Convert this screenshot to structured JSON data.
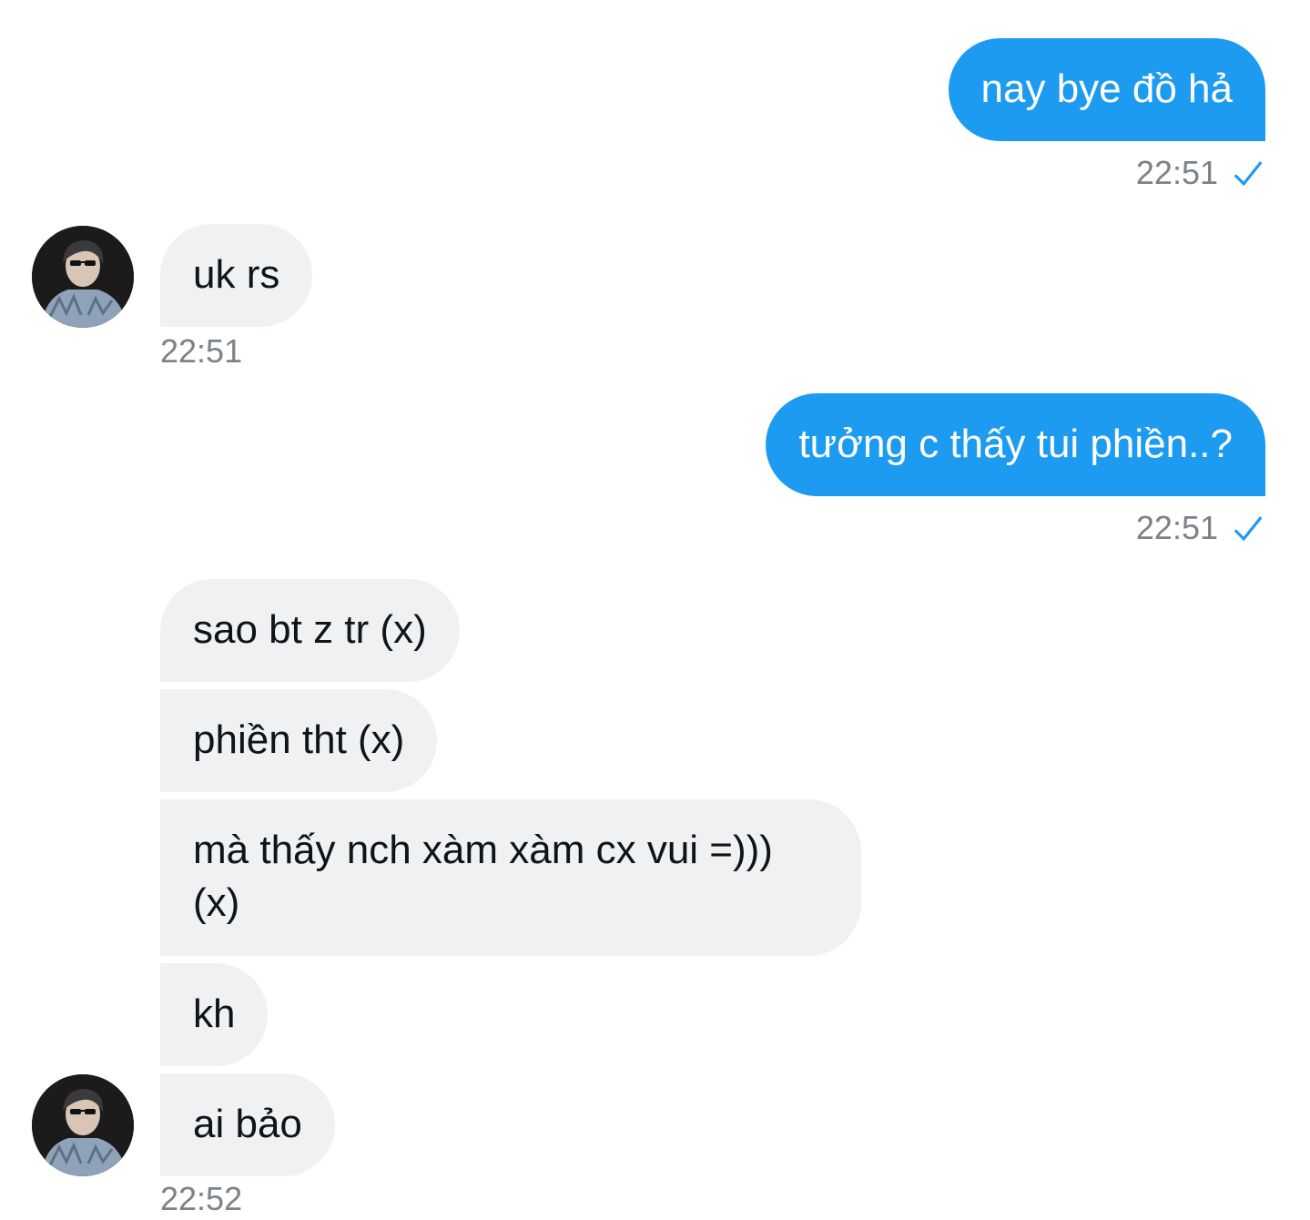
{
  "colors": {
    "outgoing_bubble": "#1d9bf0",
    "incoming_bubble": "#eff1f3",
    "timestamp": "#7b8288",
    "read_check": "#1d9bf0"
  },
  "messages": [
    {
      "direction": "outgoing",
      "text": "nay bye đồ hả",
      "time": "22:51",
      "status_icon": "check-icon"
    },
    {
      "direction": "incoming",
      "text": "uk rs",
      "time": "22:51",
      "avatar": "avatar-icon"
    },
    {
      "direction": "outgoing",
      "text": "tưởng c thấy tui phiền..?",
      "time": "22:51",
      "status_icon": "check-icon"
    },
    {
      "direction": "incoming",
      "text": "sao bt z tr (x)"
    },
    {
      "direction": "incoming",
      "text": "phiền tht (x)"
    },
    {
      "direction": "incoming",
      "text": "mà thấy nch xàm xàm cx vui =))) (x)"
    },
    {
      "direction": "incoming",
      "text": "kh"
    },
    {
      "direction": "incoming",
      "text": "ai bảo",
      "time": "22:52",
      "avatar": "avatar-icon"
    }
  ]
}
